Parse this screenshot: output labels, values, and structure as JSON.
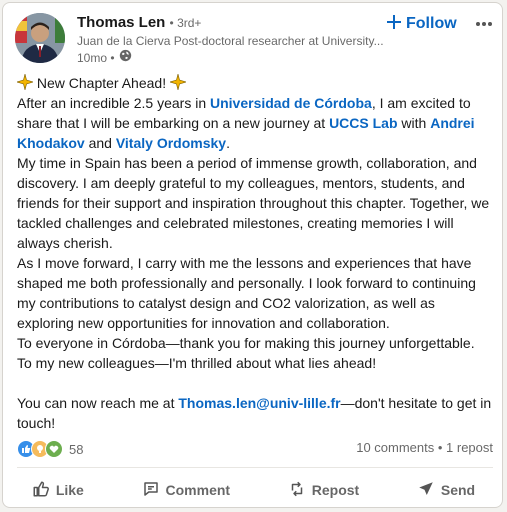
{
  "author": {
    "name": "Thomas Len",
    "degree": "• 3rd+",
    "headline": "Juan de la Cierva Post-doctoral researcher at University...",
    "time": "10mo •"
  },
  "follow_label": "Follow",
  "post": {
    "line1_text": "New Chapter Ahead!",
    "p2_a": "After an incredible 2.5 years in ",
    "p2_link1": "Universidad de Córdoba",
    "p2_b": ", I am excited to share that I will be embarking on a new journey at ",
    "p2_link2": "UCCS Lab",
    "p2_c": " with ",
    "p2_link3": "Andrei Khodakov",
    "p2_d": " and ",
    "p2_link4": "Vitaly Ordomsky",
    "p2_e": ".",
    "p3": "My time in Spain has been a period of immense growth, collaboration, and discovery. I am deeply grateful to my colleagues, mentors, students, and friends for their support and inspiration throughout this chapter. Together, we tackled challenges and celebrated milestones, creating memories I will always cherish.",
    "p4": "As I move forward, I carry with me the lessons and experiences that have shaped me both professionally and personally. I look forward to continuing my contributions to catalyst design and CO2 valorization, as well as exploring new opportunities for innovation and collaboration.",
    "p5": "To everyone in Córdoba—thank you for making this journey unforgettable.",
    "p6": "To my new colleagues—I'm thrilled about what lies ahead!",
    "p7_a": "You can now reach me at ",
    "p7_email": "Thomas.len@univ-lille.fr",
    "p7_b": "—don't hesitate to get in touch!"
  },
  "social": {
    "reaction_count": "58",
    "comments_reposts": "10 comments • 1 repost"
  },
  "actions": {
    "like": "Like",
    "comment": "Comment",
    "repost": "Repost",
    "send": "Send"
  },
  "colors": {
    "link": "#0a66c2",
    "like_blue": "#378fe9",
    "insightful_yellow": "#f5bb5c",
    "support_green": "#6dae4f"
  }
}
